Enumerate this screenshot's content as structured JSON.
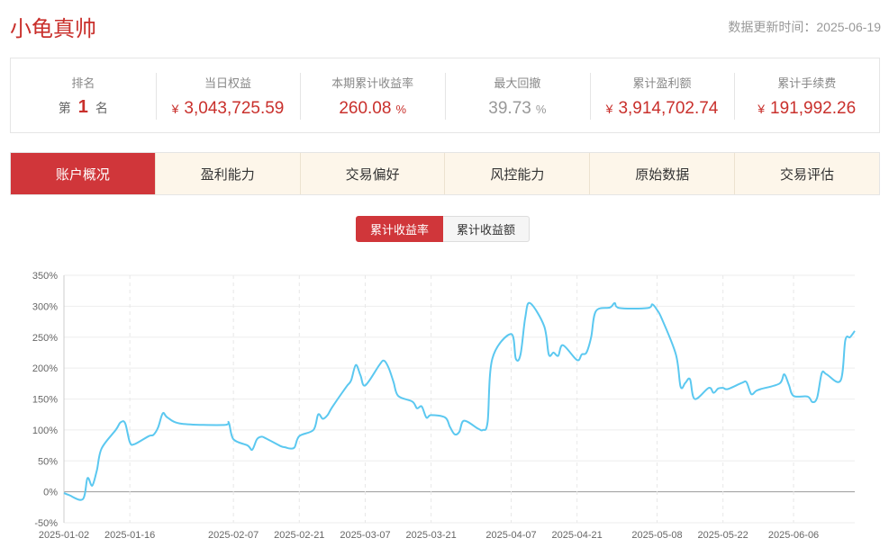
{
  "header": {
    "title": "小龟真帅",
    "update_label": "数据更新时间：",
    "update_date": "2025-06-19"
  },
  "stats": {
    "rank": {
      "label": "排名",
      "prefix": "第",
      "value": "1",
      "suffix": "名"
    },
    "daily_equity": {
      "label": "当日权益",
      "currency": "¥",
      "value": "3,043,725.59"
    },
    "cumulative_return": {
      "label": "本期累计收益率",
      "value": "260.08",
      "unit": "%"
    },
    "max_drawdown": {
      "label": "最大回撤",
      "value": "39.73",
      "unit": "%"
    },
    "cumulative_profit": {
      "label": "累计盈利额",
      "currency": "¥",
      "value": "3,914,702.74"
    },
    "cumulative_fees": {
      "label": "累计手续费",
      "currency": "¥",
      "value": "191,992.26"
    }
  },
  "tabs": [
    {
      "label": "账户概况",
      "active": true
    },
    {
      "label": "盈利能力",
      "active": false
    },
    {
      "label": "交易偏好",
      "active": false
    },
    {
      "label": "风控能力",
      "active": false
    },
    {
      "label": "原始数据",
      "active": false
    },
    {
      "label": "交易评估",
      "active": false
    }
  ],
  "chart_toggle": {
    "active": "累计收益率",
    "other": "累计收益额"
  },
  "colors": {
    "accent": "#d0363a",
    "line": "#5bc8f0",
    "tab_bg": "#fdf6ea"
  },
  "chart_data": {
    "type": "line",
    "title": "",
    "xlabel": "",
    "ylabel": "",
    "y_unit": "%",
    "ylim": [
      -50,
      350
    ],
    "y_ticks": [
      -50,
      0,
      50,
      100,
      150,
      200,
      250,
      300,
      350
    ],
    "y_tick_labels": [
      "-50%",
      "0%",
      "50%",
      "100%",
      "150%",
      "200%",
      "250%",
      "300%",
      "350%"
    ],
    "x_range": [
      "2025-01-02",
      "2025-06-19"
    ],
    "x_ticks": [
      "2025-01-02",
      "2025-01-16",
      "2025-02-07",
      "2025-02-21",
      "2025-03-07",
      "2025-03-21",
      "2025-04-07",
      "2025-04-21",
      "2025-05-08",
      "2025-05-22",
      "2025-06-06"
    ],
    "grid": true,
    "series": [
      {
        "x": [
          "2025-01-02",
          "2025-01-03",
          "2025-01-06",
          "2025-01-07",
          "2025-01-08",
          "2025-01-09",
          "2025-01-10",
          "2025-01-13",
          "2025-01-14",
          "2025-01-15",
          "2025-01-16",
          "2025-01-17",
          "2025-01-20",
          "2025-01-21",
          "2025-01-22",
          "2025-01-23",
          "2025-01-24",
          "2025-01-27",
          "2025-02-05",
          "2025-02-06",
          "2025-02-07",
          "2025-02-10",
          "2025-02-11",
          "2025-02-12",
          "2025-02-13",
          "2025-02-14",
          "2025-02-17",
          "2025-02-18",
          "2025-02-19",
          "2025-02-20",
          "2025-02-21",
          "2025-02-24",
          "2025-02-25",
          "2025-02-26",
          "2025-02-27",
          "2025-02-28",
          "2025-03-03",
          "2025-03-04",
          "2025-03-05",
          "2025-03-06",
          "2025-03-07",
          "2025-03-10",
          "2025-03-11",
          "2025-03-12",
          "2025-03-13",
          "2025-03-14",
          "2025-03-17",
          "2025-03-18",
          "2025-03-19",
          "2025-03-20",
          "2025-03-21",
          "2025-03-24",
          "2025-03-25",
          "2025-03-26",
          "2025-03-27",
          "2025-03-28",
          "2025-03-31",
          "2025-04-01",
          "2025-04-02",
          "2025-04-03",
          "2025-04-07",
          "2025-04-08",
          "2025-04-09",
          "2025-04-10",
          "2025-04-11",
          "2025-04-14",
          "2025-04-15",
          "2025-04-16",
          "2025-04-17",
          "2025-04-18",
          "2025-04-21",
          "2025-04-22",
          "2025-04-23",
          "2025-04-24",
          "2025-04-25",
          "2025-04-28",
          "2025-04-29",
          "2025-04-30",
          "2025-05-06",
          "2025-05-07",
          "2025-05-08",
          "2025-05-09",
          "2025-05-12",
          "2025-05-13",
          "2025-05-14",
          "2025-05-15",
          "2025-05-16",
          "2025-05-19",
          "2025-05-20",
          "2025-05-21",
          "2025-05-22",
          "2025-05-23",
          "2025-05-26",
          "2025-05-27",
          "2025-05-28",
          "2025-05-29",
          "2025-05-30",
          "2025-06-03",
          "2025-06-04",
          "2025-06-05",
          "2025-06-06",
          "2025-06-09",
          "2025-06-10",
          "2025-06-11",
          "2025-06-12",
          "2025-06-13",
          "2025-06-16",
          "2025-06-17",
          "2025-06-18",
          "2025-06-19"
        ],
        "y": [
          -2,
          -5,
          -12,
          22,
          10,
          35,
          70,
          100,
          112,
          111,
          80,
          77,
          90,
          92,
          104,
          127,
          120,
          110,
          108,
          112,
          85,
          75,
          68,
          85,
          89,
          86,
          74,
          72,
          70,
          72,
          90,
          100,
          125,
          118,
          124,
          137,
          170,
          180,
          205,
          188,
          172,
          205,
          212,
          200,
          178,
          155,
          146,
          135,
          138,
          120,
          124,
          120,
          105,
          93,
          97,
          115,
          102,
          100,
          113,
          215,
          255,
          215,
          222,
          282,
          305,
          268,
          222,
          225,
          220,
          237,
          213,
          222,
          225,
          250,
          292,
          298,
          305,
          297,
          297,
          303,
          294,
          280,
          222,
          170,
          176,
          182,
          150,
          168,
          160,
          167,
          168,
          166,
          176,
          177,
          158,
          163,
          166,
          175,
          190,
          173,
          155,
          154,
          145,
          152,
          192,
          190,
          180,
          245,
          250,
          260
        ]
      }
    ]
  }
}
